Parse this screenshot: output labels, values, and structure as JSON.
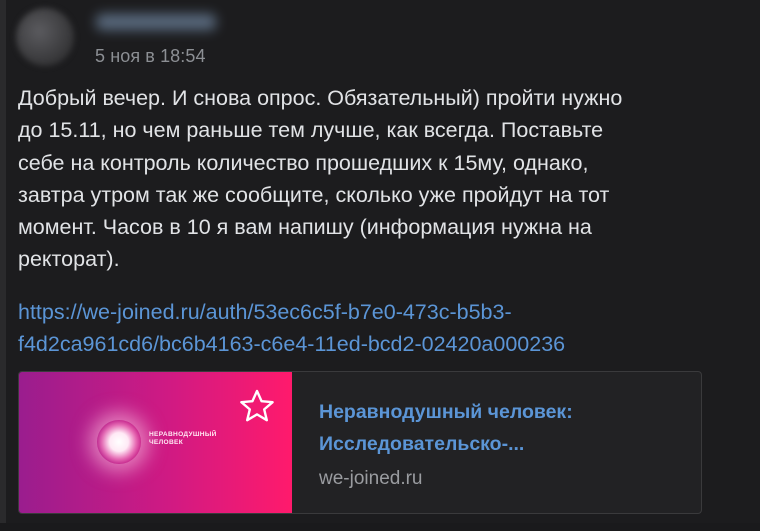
{
  "message": {
    "timestamp": "5 ноя в 18:54",
    "text_lines": [
      "Добрый вечер. И снова опрос. Обязательный) пройти нужно",
      "до 15.11, но чем раньше тем лучше, как всегда. Поставьте",
      "себе на контроль количество прошедших к 15му, однако,",
      "завтра утром так же сообщите, сколько уже пройдут на тот",
      "момент. Часов в 10 я вам напишу (информация нужна на",
      "ректорат)."
    ],
    "link_lines": [
      "https://we-joined.ru/auth/53ec6c5f-b7e0-473c-b5b3-",
      "f4d2ca961cd6/bc6b4163-c6e4-11ed-bcd2-02420a000236"
    ]
  },
  "preview": {
    "brand_lines": [
      "НЕРАВНОДУШНЫЙ",
      "ЧЕЛОВЕК"
    ],
    "title_lines": [
      "Неравнодушный человек:",
      "Исследовательско-..."
    ],
    "domain": "we-joined.ru",
    "icons": {
      "star": "star-outline-icon",
      "glow": "glow-circle-logo"
    },
    "colors": {
      "gradient_start": "#9a1d8e",
      "gradient_end": "#ff1a6c",
      "link": "#5b95d6"
    }
  }
}
